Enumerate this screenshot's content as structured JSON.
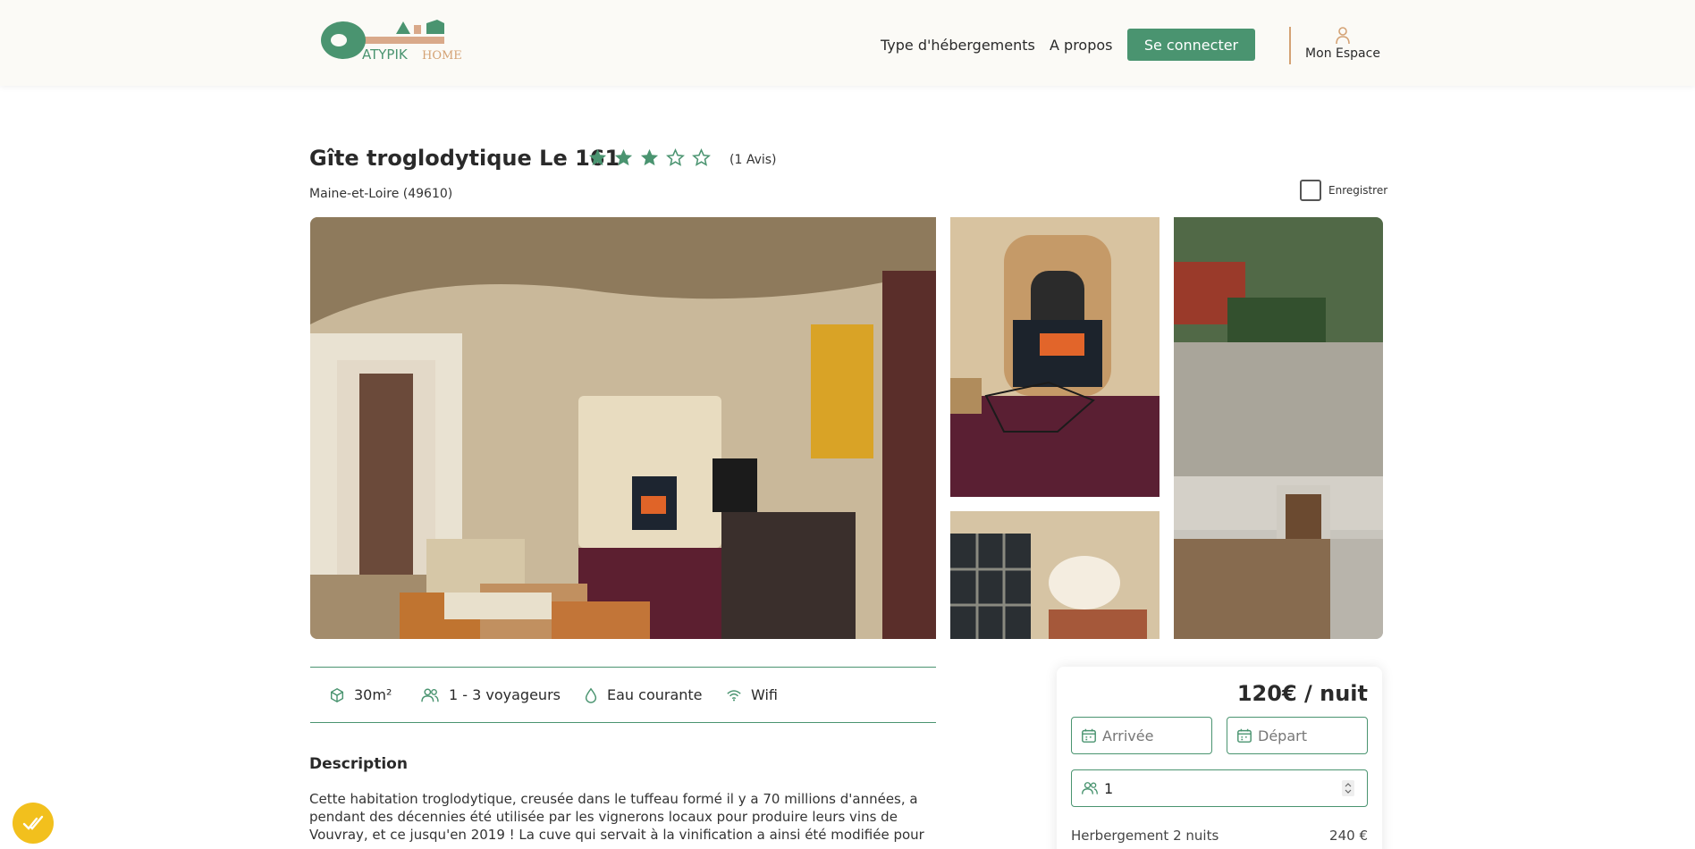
{
  "header": {
    "logo_text_1": "ATYPIK",
    "logo_text_2": "HOME",
    "nav": {
      "types": "Type d'hébergements",
      "about": "A propos"
    },
    "login_label": "Se connecter",
    "account_label": "Mon Espace"
  },
  "listing": {
    "title": "Gîte troglodytique Le 161",
    "rating": 3,
    "rating_max": 5,
    "reviews": "(1 Avis)",
    "location": "Maine-et-Loire (49610)",
    "save_label": "Enregistrer"
  },
  "amenities": {
    "size": "30m²",
    "guests": "1 - 3 voyageurs",
    "water": "Eau courante",
    "wifi": "Wifi"
  },
  "description": {
    "heading": "Description",
    "text": "Cette habitation troglodytique, creusée dans le tuffeau formé il y a 70 millions d'années, a pendant des décennies été utilisée par les vignerons locaux pour produire leurs vins de Vouvray, et ce jusqu'en 2019 ! La cuve qui servait à la vinification a ainsi été modifiée pour en"
  },
  "booking": {
    "price": "120€ / nuit",
    "arrival_placeholder": "Arrivée",
    "departure_placeholder": "Départ",
    "guests_value": "1",
    "stay_label": "Herbergement 2 nuits",
    "stay_price": "240 €"
  },
  "colors": {
    "brand_green": "#4a9470",
    "brand_tan": "#d4a274",
    "badge_yellow": "#f2c01d"
  }
}
